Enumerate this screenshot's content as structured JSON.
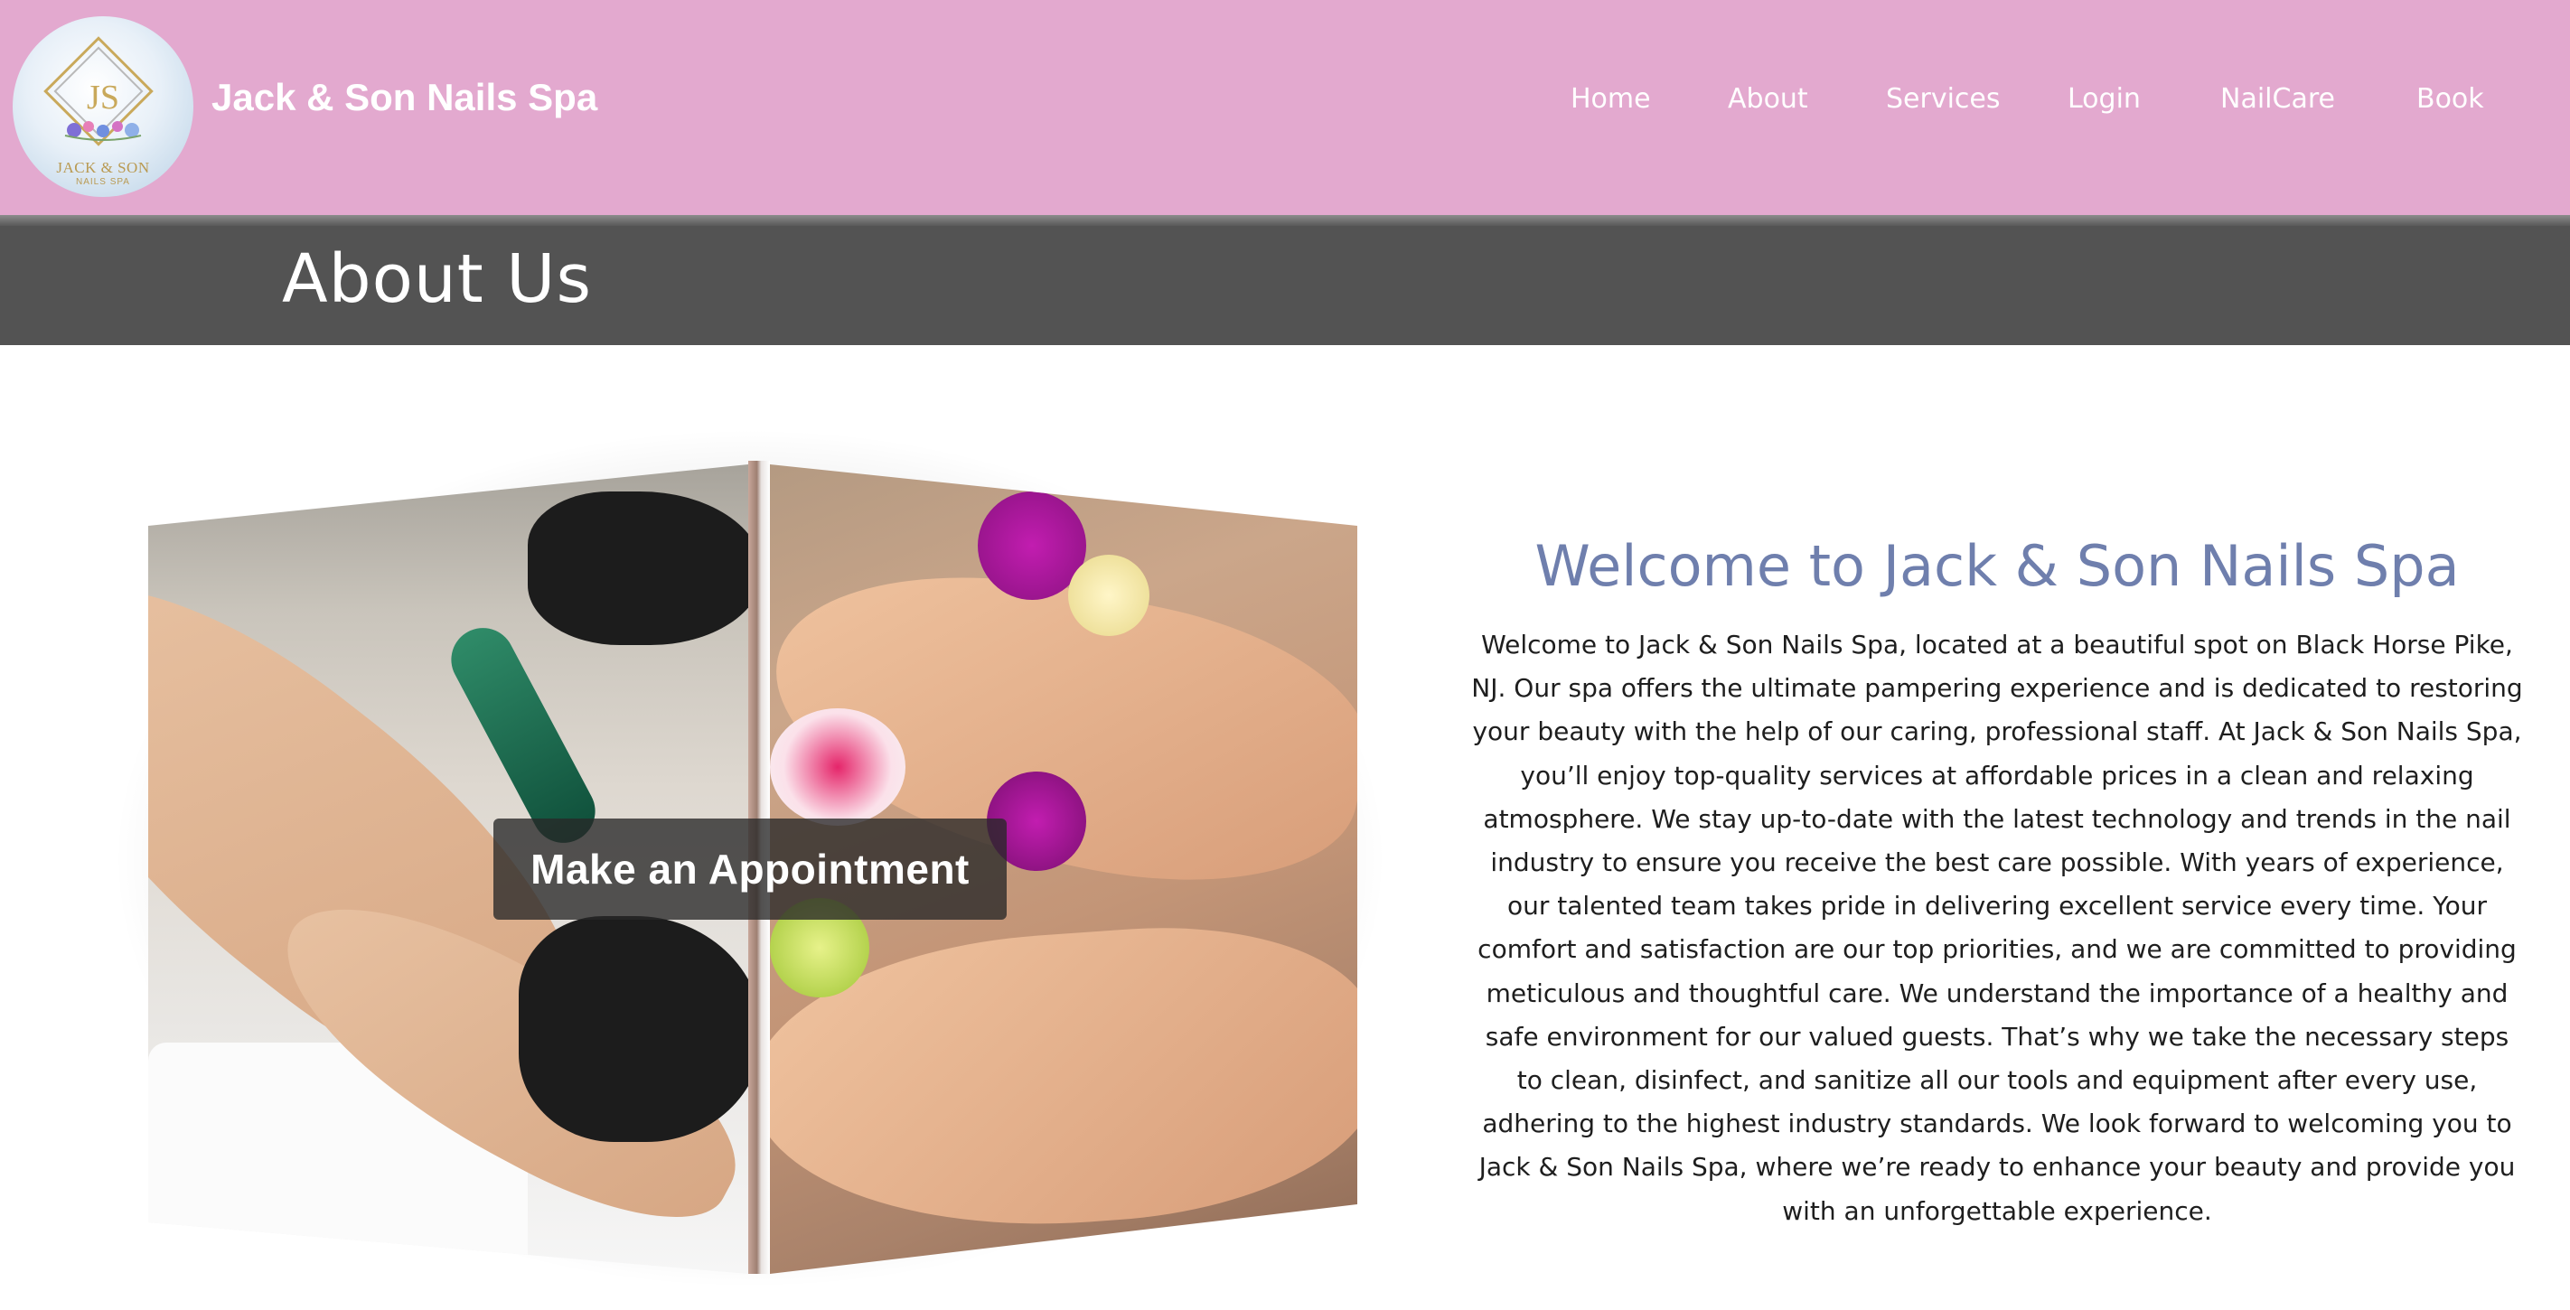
{
  "header": {
    "brand": "Jack & Son Nails Spa",
    "logo": {
      "monogram": "JS",
      "name": "JACK & SON",
      "sub": "NAILS SPA"
    },
    "nav": [
      "Home",
      "About",
      "Services",
      "Login",
      "NailCare",
      "Book"
    ]
  },
  "band": {
    "title": "About Us"
  },
  "hero": {
    "appointment_label": "Make an Appointment"
  },
  "welcome": {
    "title": "Welcome to Jack & Son Nails Spa",
    "body": "Welcome to Jack & Son Nails Spa, located at a beautiful spot on Black Horse Pike, NJ. Our spa offers the ultimate pampering experience and is dedicated to restoring your beauty with the help of our caring, professional staff. At Jack & Son Nails Spa, you’ll enjoy top-quality services at affordable prices in a clean and relaxing atmosphere. We stay up-to-date with the latest technology and trends in the nail industry to ensure you receive the best care possible. With years of experience, our talented team takes pride in delivering excellent service every time. Your comfort and satisfaction are our top priorities, and we are committed to providing meticulous and thoughtful care. We understand the importance of a healthy and safe environment for our valued guests. That’s why we take the necessary steps to clean, disinfect, and sanitize all our tools and equipment after every use, adhering to the highest industry standards. We look forward to welcoming you to Jack & Son Nails Spa, where we’re ready to enhance your beauty and provide you with an unforgettable experience."
  },
  "colors": {
    "header_bg": "#e3a9cf",
    "band_bg": "#535353",
    "title_accent": "#6f7fad"
  }
}
